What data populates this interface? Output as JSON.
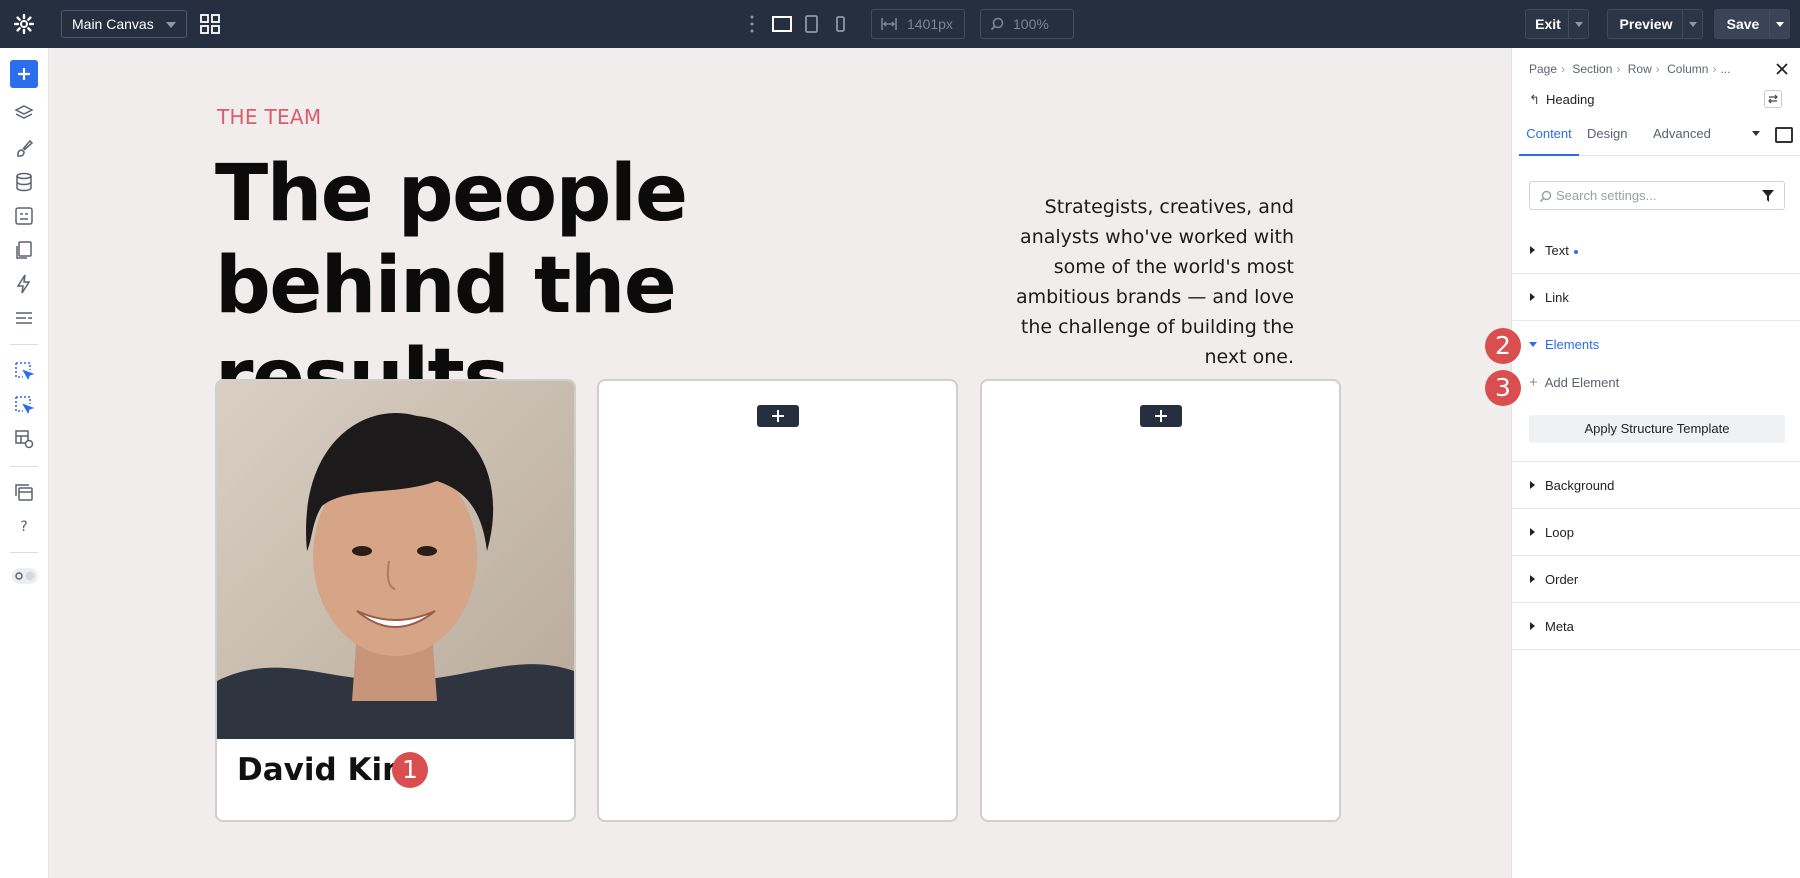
{
  "topbar": {
    "canvas_select": "Main Canvas",
    "width_value": "1401px",
    "zoom_value": "100%",
    "exit_label": "Exit",
    "preview_label": "Preview",
    "save_label": "Save"
  },
  "canvas": {
    "eyebrow": "THE TEAM",
    "headline": "The people behind the results.",
    "intro": "Strategists, creatives, and analysts who've worked with some of the world's most ambitious brands — and love the challenge of building the next one.",
    "cards": [
      {
        "name": "David Kim",
        "badge": "1"
      }
    ]
  },
  "panel": {
    "breadcrumb": [
      "Page",
      "Section",
      "Row",
      "Column",
      "..."
    ],
    "element_title": "Heading",
    "tabs": [
      "Content",
      "Design",
      "Advanced"
    ],
    "search_placeholder": "Search settings...",
    "groups": [
      "Text",
      "Link",
      "Elements",
      "Background",
      "Loop",
      "Order",
      "Meta"
    ],
    "add_element": "Add Element",
    "apply_template": "Apply Structure Template",
    "badge2": "2",
    "badge3": "3"
  },
  "colors": {
    "topbar": "#262f3f",
    "accent": "#2b6dea",
    "eyebrow": "#dd5b6e",
    "badge": "#d94f4f",
    "canvas_bg": "#f0edec"
  }
}
